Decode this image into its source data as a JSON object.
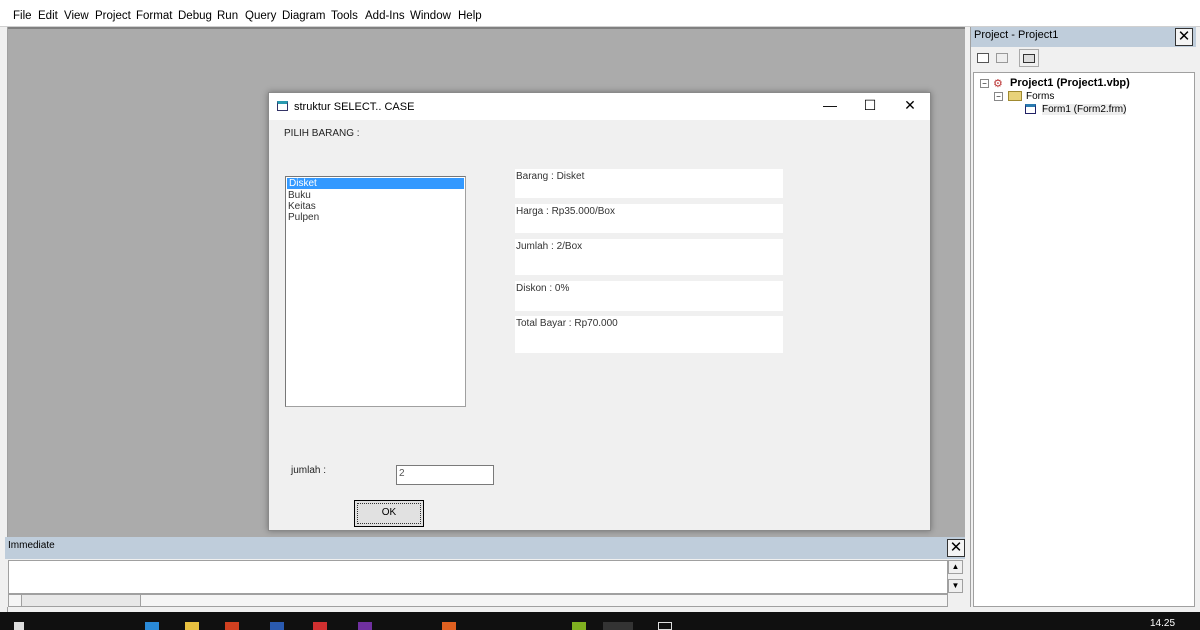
{
  "menu": [
    "File",
    "Edit",
    "View",
    "Project",
    "Format",
    "Debug",
    "Run",
    "Query",
    "Diagram",
    "Tools",
    "Add-Ins",
    "Window",
    "Help"
  ],
  "project": {
    "title": "Project - Project1",
    "root": "Project1 (Project1.vbp)",
    "folder": "Forms",
    "form": "Form1 (Form2.frm)"
  },
  "immediate": {
    "title": "Immediate"
  },
  "form": {
    "title": "struktur SELECT.. CASE",
    "prompt": "PILIH BARANG :",
    "items": [
      "Disket",
      "Buku",
      "Keitas",
      "Pulpen"
    ],
    "selected": "Disket",
    "outputs": [
      "Barang : Disket",
      "Harga : Rp35.000/Box",
      "Jumlah : 2/Box",
      "Diskon : 0%",
      "Total Bayar : Rp70.000"
    ],
    "jumlah_label": "jumlah :",
    "jumlah_value": "2",
    "ok": "OK"
  },
  "taskbar": {
    "clock": "14.25"
  },
  "colors": {
    "selection": "#3399ff",
    "panel_title": "#bfcddb",
    "mdi": "#ababab"
  }
}
